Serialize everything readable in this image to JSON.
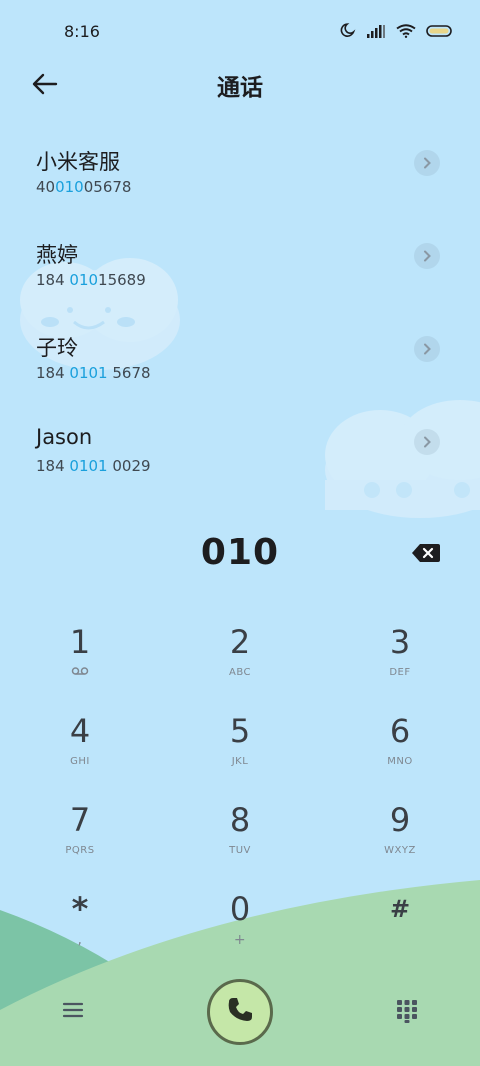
{
  "status_bar": {
    "time": "8:16",
    "icons": [
      "moon-icon",
      "cellular-signal-icon",
      "wifi-icon",
      "battery-icon"
    ]
  },
  "header": {
    "title": "通话",
    "back_icon": "arrow-left-icon"
  },
  "contacts": [
    {
      "name": "小米客服",
      "number_parts": [
        "40",
        "010",
        "05678"
      ]
    },
    {
      "name": "燕婷",
      "number_parts": [
        "184 ",
        "010",
        "15689"
      ]
    },
    {
      "name": "子玲",
      "number_parts": [
        "184 ",
        "0101",
        " 5678"
      ]
    },
    {
      "name": "Jason",
      "number_parts": [
        "184 ",
        "0101",
        " 0029"
      ]
    }
  ],
  "dialer": {
    "entered_number": "010",
    "backspace_icon": "backspace-icon"
  },
  "keypad": [
    {
      "digit": "1",
      "sub": "",
      "sub_icon": "voicemail-icon"
    },
    {
      "digit": "2",
      "sub": "ABC"
    },
    {
      "digit": "3",
      "sub": "DEF"
    },
    {
      "digit": "4",
      "sub": "GHI"
    },
    {
      "digit": "5",
      "sub": "JKL"
    },
    {
      "digit": "6",
      "sub": "MNO"
    },
    {
      "digit": "7",
      "sub": "PQRS"
    },
    {
      "digit": "8",
      "sub": "TUV"
    },
    {
      "digit": "9",
      "sub": "WXYZ"
    },
    {
      "digit": "*",
      "sub": ","
    },
    {
      "digit": "0",
      "sub": "+"
    },
    {
      "digit": "#",
      "sub": ""
    }
  ],
  "bottom_bar": {
    "menu_icon": "menu-icon",
    "call_icon": "phone-icon",
    "dialpad_icon": "dialpad-icon"
  },
  "colors": {
    "background": "#bde5fb",
    "highlight": "#1aa0dc",
    "call_button": "#c5e7a8",
    "hill_front": "#a8d9b1",
    "hill_back": "#7cc4a6"
  }
}
